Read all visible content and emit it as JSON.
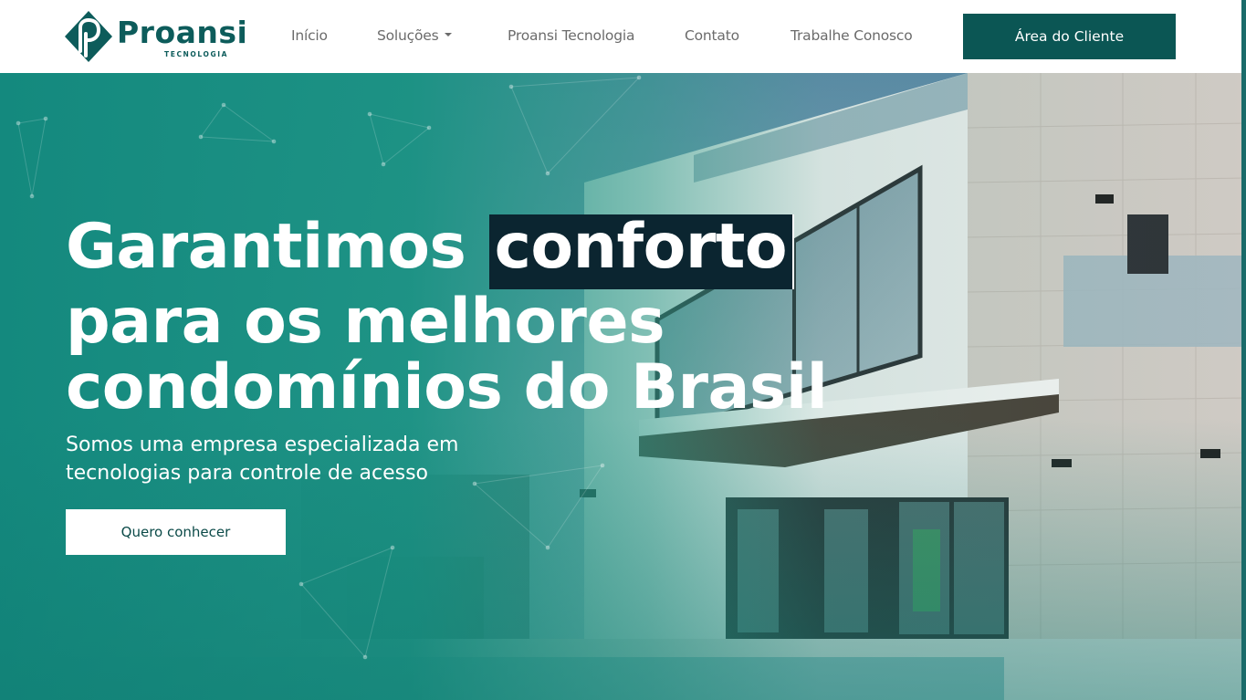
{
  "brand": {
    "name": "Proansi",
    "tagline": "TECNOLOGIA",
    "logo_icon": "proansi-p-diamond-icon",
    "color_primary": "#0b5654"
  },
  "nav": {
    "items": [
      {
        "label": "Início"
      },
      {
        "label": "Soluções",
        "dropdown": true
      },
      {
        "label": "Proansi Tecnologia"
      },
      {
        "label": "Contato"
      },
      {
        "label": "Trabalhe Conosco"
      }
    ],
    "client_button": "Área do Cliente"
  },
  "hero": {
    "title_part1": "Garantimos ",
    "title_highlight": "conforto",
    "title_line2": "para os melhores",
    "title_line3": "condomínios do Brasil",
    "subtitle_line1": "Somos uma empresa especializada em",
    "subtitle_line2": "tecnologias para controle de acesso",
    "cta_label": "Quero conhecer",
    "highlight_color": "#0b2530"
  }
}
